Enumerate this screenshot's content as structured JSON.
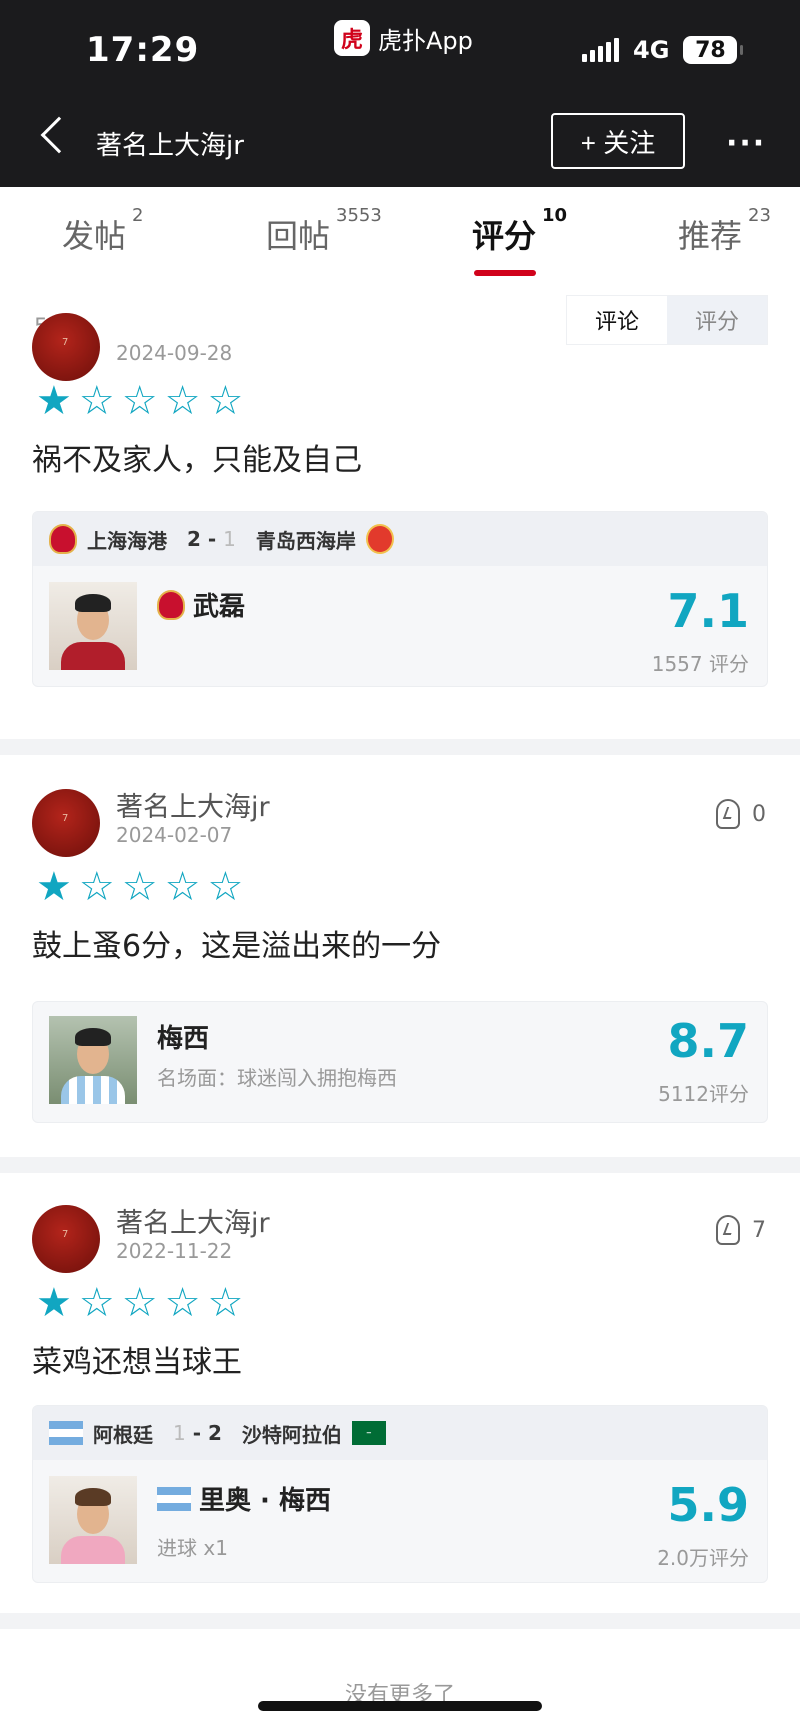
{
  "status": {
    "time": "17:29",
    "app_name": "虎扑App",
    "app_logo_char": "虎",
    "network": "4G",
    "battery": "78"
  },
  "nav": {
    "title": "著名上大海jr",
    "follow_label": "+ 关注",
    "more_icon": "more-dots-icon"
  },
  "tabs": [
    {
      "label": "发帖",
      "count": "2"
    },
    {
      "label": "回帖",
      "count": "3553"
    },
    {
      "label": "评分",
      "count": "10"
    },
    {
      "label": "推荐",
      "count": "23"
    }
  ],
  "list": {
    "count_label": "5条",
    "toggle": {
      "comments": "评论",
      "ratings": "评分"
    }
  },
  "items": [
    {
      "date": "2024-09-28",
      "stars_filled": 1,
      "stars_total": 5,
      "comment": "祸不及家人，只能及自己",
      "match": {
        "home": "上海海港",
        "home_score": "2",
        "away_score": "1",
        "away": "青岛西海岸"
      },
      "player": {
        "name": "武磊",
        "score": "7.1",
        "rating_count": "1557 评分"
      }
    },
    {
      "user": "著名上大海jr",
      "date": "2024-02-07",
      "likes": "0",
      "stars_filled": 1,
      "stars_total": 5,
      "comment": "鼓上蚤6分，这是溢出来的一分",
      "player": {
        "name": "梅西",
        "sub": "名场面：球迷闯入拥抱梅西",
        "score": "8.7",
        "rating_count": "5112评分"
      }
    },
    {
      "user": "著名上大海jr",
      "date": "2022-11-22",
      "likes": "7",
      "stars_filled": 1,
      "stars_total": 5,
      "comment": "菜鸡还想当球王",
      "match": {
        "home": "阿根廷",
        "home_score": "1",
        "away_score": "2",
        "away": "沙特阿拉伯"
      },
      "player": {
        "name": "里奥 · 梅西",
        "sub": "进球 x1",
        "score": "5.9",
        "rating_count": "2.0万评分"
      }
    }
  ],
  "footer": {
    "no_more": "没有更多了"
  },
  "colors": {
    "accent": "#d0021b",
    "star": "#11a6c1",
    "score": "#11a6c1",
    "header_bg": "#1b1b1d"
  }
}
